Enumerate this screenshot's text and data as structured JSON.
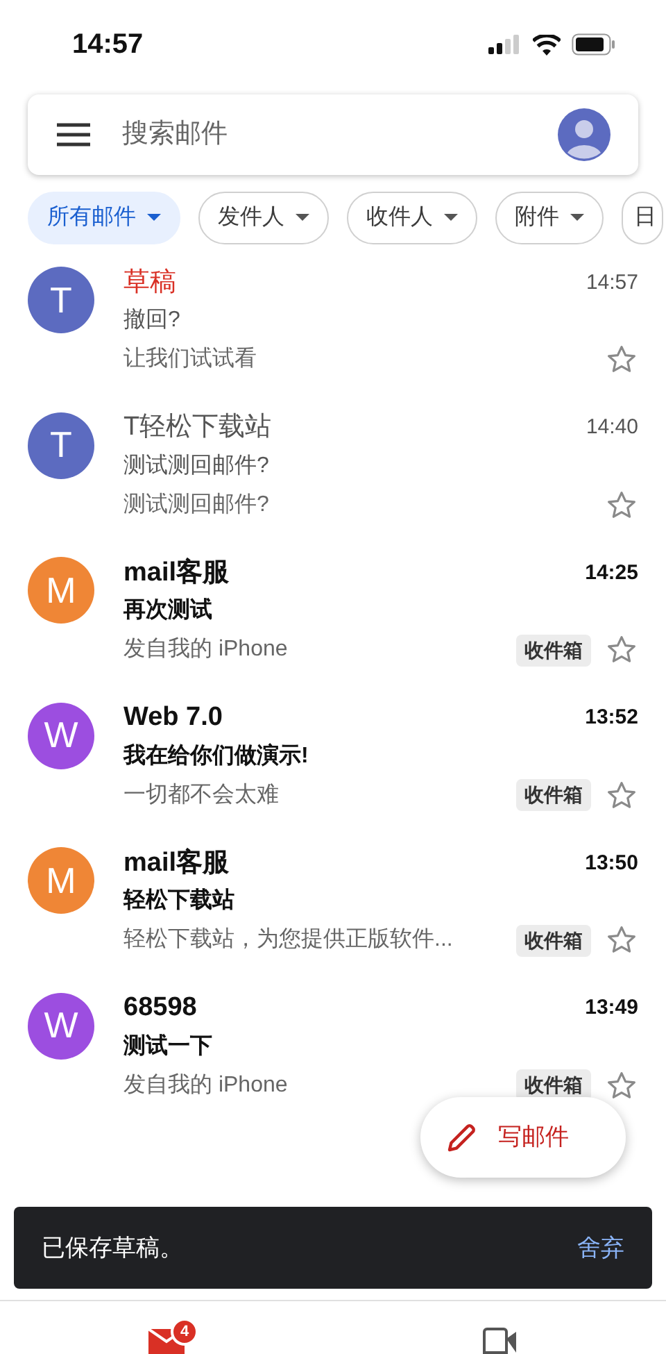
{
  "status_bar": {
    "time": "14:57"
  },
  "search": {
    "placeholder": "搜索邮件"
  },
  "filters": [
    {
      "label": "所有邮件",
      "selected": true,
      "dropdown": true
    },
    {
      "label": "发件人",
      "selected": false,
      "dropdown": true
    },
    {
      "label": "收件人",
      "selected": false,
      "dropdown": true
    },
    {
      "label": "附件",
      "selected": false,
      "dropdown": true
    },
    {
      "label": "日",
      "selected": false,
      "dropdown": false
    }
  ],
  "emails": [
    {
      "avatar": "T",
      "color": "#5c6bc0",
      "sender": "草稿",
      "draft": true,
      "unread": false,
      "time": "14:57",
      "subject": "撤回?",
      "snippet": "让我们试试看",
      "starred": false
    },
    {
      "avatar": "T",
      "color": "#5c6bc0",
      "sender": "T轻松下载站",
      "draft": false,
      "unread": false,
      "time": "14:40",
      "subject": "测试测回邮件?",
      "snippet": "测试测回邮件?",
      "starred": false
    },
    {
      "avatar": "M",
      "color": "#ef8636",
      "sender": "mail客服",
      "draft": false,
      "unread": true,
      "time": "14:25",
      "subject": "再次测试",
      "snippet": "发自我的 iPhone",
      "label": "收件箱",
      "starred": false
    },
    {
      "avatar": "W",
      "color": "#9c4ee0",
      "sender": "Web 7.0",
      "draft": false,
      "unread": true,
      "time": "13:52",
      "subject": "我在给你们做演示!",
      "snippet": "一切都不会太难",
      "label": "收件箱",
      "starred": false
    },
    {
      "avatar": "M",
      "color": "#ef8636",
      "sender": "mail客服",
      "draft": false,
      "unread": true,
      "time": "13:50",
      "subject": "轻松下载站",
      "snippet": "轻松下载站，为您提供正版软件...",
      "label": "收件箱",
      "starred": false
    },
    {
      "avatar": "W",
      "color": "#9c4ee0",
      "sender": "68598",
      "draft": false,
      "unread": true,
      "time": "13:49",
      "subject": "测试一下",
      "snippet": "发自我的 iPhone",
      "label": "收件箱",
      "starred": false
    }
  ],
  "compose": {
    "label": "写邮件"
  },
  "snackbar": {
    "message": "已保存草稿。",
    "action": "舍弃"
  },
  "bottom_nav": {
    "mail_badge": "4"
  }
}
